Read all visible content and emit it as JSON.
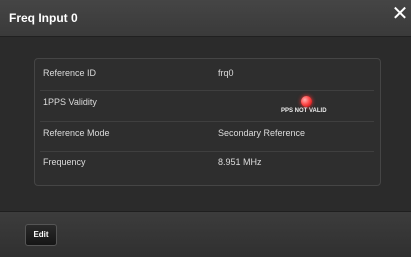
{
  "dialog": {
    "title": "Freq Input 0",
    "close_label": "✕"
  },
  "fields": [
    {
      "label": "Reference ID",
      "value": "frq0"
    },
    {
      "label": "1PPS Validity",
      "status_text": "PPS NOT VALID",
      "status_color": "#ff3b3b"
    },
    {
      "label": "Reference Mode",
      "value": "Secondary Reference"
    },
    {
      "label": "Frequency",
      "value": "8.951 MHz"
    }
  ],
  "footer": {
    "edit_label": "Edit"
  }
}
